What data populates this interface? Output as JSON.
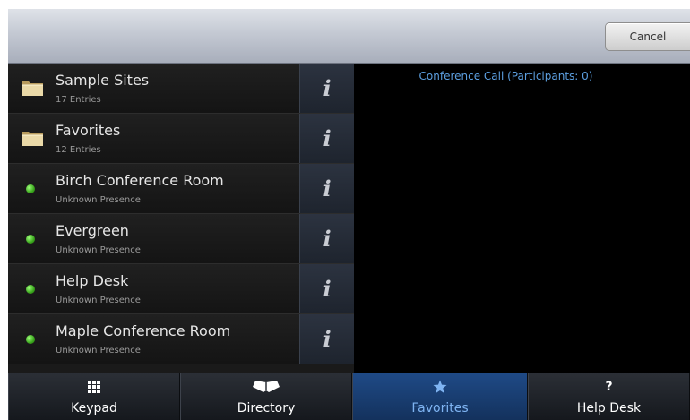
{
  "header": {
    "cancel_label": "Cancel"
  },
  "entries": [
    {
      "title": "Sample Sites",
      "subtitle": "17 Entries",
      "type": "folder"
    },
    {
      "title": "Favorites",
      "subtitle": "12 Entries",
      "type": "folder"
    },
    {
      "title": "Birch Conference Room",
      "subtitle": "Unknown Presence",
      "type": "contact"
    },
    {
      "title": "Evergreen",
      "subtitle": "Unknown Presence",
      "type": "contact"
    },
    {
      "title": "Help Desk",
      "subtitle": "Unknown Presence",
      "type": "contact"
    },
    {
      "title": "Maple Conference Room",
      "subtitle": "Unknown Presence",
      "type": "contact"
    }
  ],
  "info_glyph": "i",
  "conference": {
    "title": "Conference Call (Participants: 0)"
  },
  "nav": {
    "tabs": [
      {
        "label": "Keypad",
        "icon": "keypad-icon",
        "active": false
      },
      {
        "label": "Directory",
        "icon": "book-icon",
        "active": false
      },
      {
        "label": "Favorites",
        "icon": "star-icon",
        "active": true
      },
      {
        "label": "Help Desk",
        "icon": "question-icon",
        "glyph": "?",
        "active": false
      }
    ]
  },
  "colors": {
    "accent": "#5c9fe0",
    "active_tab": "#1f4a86",
    "presence": "#3aa61c"
  }
}
